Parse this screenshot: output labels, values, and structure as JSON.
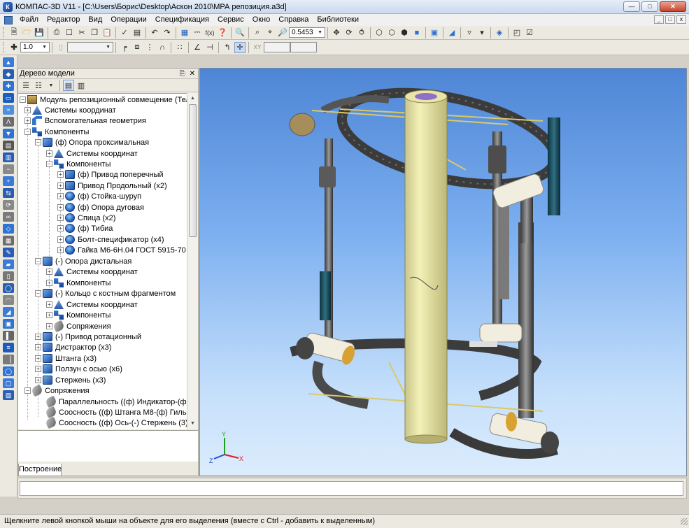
{
  "window": {
    "title": "КОМПАС-3D V11 - [C:\\Users\\Борис\\Desktop\\Аскон 2010\\МРА репозиция.a3d]"
  },
  "menu": [
    "Файл",
    "Редактор",
    "Вид",
    "Операции",
    "Спецификация",
    "Сервис",
    "Окно",
    "Справка",
    "Библиотеки"
  ],
  "toolbar": {
    "zoom_value": "0.5453",
    "step_value": "1.0"
  },
  "tree": {
    "panel_title": "Дерево модели",
    "tab_label": "Построение",
    "nodes": [
      {
        "label": "Модуль репозиционный совмещение (Тел-0, Ком"
      },
      {
        "label": "Системы координат"
      },
      {
        "label": "Вспомогательная геометрия"
      },
      {
        "label": "Компоненты"
      },
      {
        "label": "(ф) Опора проксимальная"
      },
      {
        "label": "Системы координат"
      },
      {
        "label": "Компоненты"
      },
      {
        "label": "(ф) Привод поперечный"
      },
      {
        "label": "Привод Продольный  (x2)"
      },
      {
        "label": "(ф) Стойка-шуруп"
      },
      {
        "label": "(ф) Опора дуговая"
      },
      {
        "label": "Спица (x2)"
      },
      {
        "label": "(ф) Тибиа"
      },
      {
        "label": "Болт-спецификатор (x4)"
      },
      {
        "label": "Гайка  М6-6Н.04 ГОСТ 5915-70 (x4)"
      },
      {
        "label": "(-) Опора дистальная"
      },
      {
        "label": "Системы координат"
      },
      {
        "label": "Компоненты"
      },
      {
        "label": "(-) Кольцо с костным фрагментом"
      },
      {
        "label": "Системы координат"
      },
      {
        "label": "Компоненты"
      },
      {
        "label": "Сопряжения"
      },
      {
        "label": "(-) Привод ротационный"
      },
      {
        "label": "Дистрактор (x3)"
      },
      {
        "label": "Штанга (x3)"
      },
      {
        "label": "Ползун с осью (x6)"
      },
      {
        "label": "Стержень (x3)"
      },
      {
        "label": "Сопряжения"
      },
      {
        "label": "Параллельность ((ф) Индикатор-(ф) Гильза"
      },
      {
        "label": "Соосность ((ф) Штанга М8-(ф) Гильза)"
      },
      {
        "label": "Соосность ((ф) Ось-(-) Стержень (3))"
      }
    ]
  },
  "axes": {
    "x": "X",
    "y": "Y",
    "z": "Z"
  },
  "statusbar": {
    "text": "Щелкните левой кнопкой мыши на объекте для его выделения (вместе с Ctrl - добавить к выделенным)"
  }
}
